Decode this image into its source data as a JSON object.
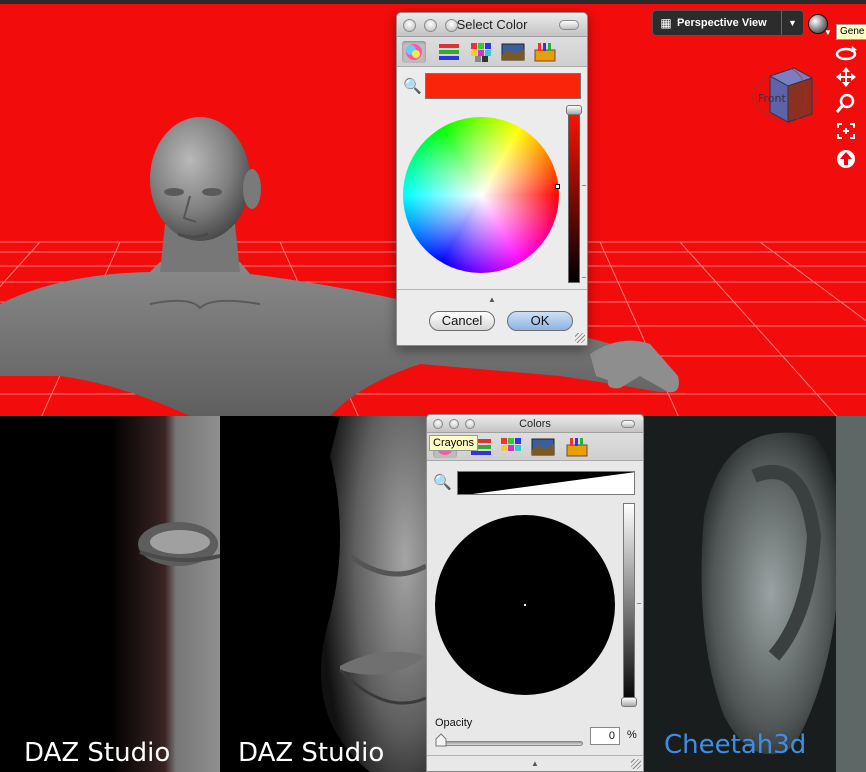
{
  "viewport": {
    "view_selector": {
      "label": "Perspective View",
      "dropdown_glyph": "▼"
    },
    "tooltip": "Gene",
    "view_cube_face": "Front",
    "nav_icons": [
      "orbit-icon",
      "pan-icon",
      "zoom-icon",
      "frame-icon",
      "home-icon"
    ],
    "background_color": "#f20c0c"
  },
  "select_color_dialog": {
    "title": "Select Color",
    "modes": [
      "color-wheel-icon",
      "color-sliders-icon",
      "color-palettes-icon",
      "image-palettes-icon",
      "crayons-icon"
    ],
    "current_color": "#fa2409",
    "cancel_label": "Cancel",
    "ok_label": "OK"
  },
  "colors_panel": {
    "title": "Colors",
    "tooltip": "Crayons",
    "current_color": "#000000",
    "opacity_label": "Opacity",
    "opacity_value": "0",
    "opacity_unit": "%",
    "opacity_fraction": 0
  },
  "comparison_labels": {
    "left": "DAZ Studio",
    "middle": "DAZ Studio",
    "right": "Cheetah3d"
  },
  "colors": {
    "cheetah_label": "#3d8fe6"
  }
}
